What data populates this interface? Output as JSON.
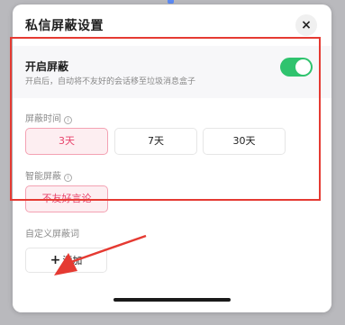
{
  "dialog": {
    "title": "私信屏蔽设置",
    "close_icon": "×"
  },
  "toggle_section": {
    "title": "开启屏蔽",
    "description": "开启后，自动将不友好的会话移至垃圾消息盒子",
    "enabled": true
  },
  "duration_section": {
    "label": "屏蔽时间",
    "info_icon": "i",
    "options": [
      {
        "label": "3天",
        "selected": true
      },
      {
        "label": "7天",
        "selected": false
      },
      {
        "label": "30天",
        "selected": false
      }
    ]
  },
  "smart_section": {
    "label": "智能屏蔽",
    "info_icon": "i",
    "options": [
      {
        "label": "不友好言论",
        "selected": true
      }
    ]
  },
  "custom_section": {
    "label": "自定义屏蔽词",
    "add_plus": "+",
    "add_label": "添加"
  },
  "colors": {
    "accent_green": "#2fc36e",
    "selected_pink": "#e8436b",
    "annotation_red": "#e53a32"
  }
}
